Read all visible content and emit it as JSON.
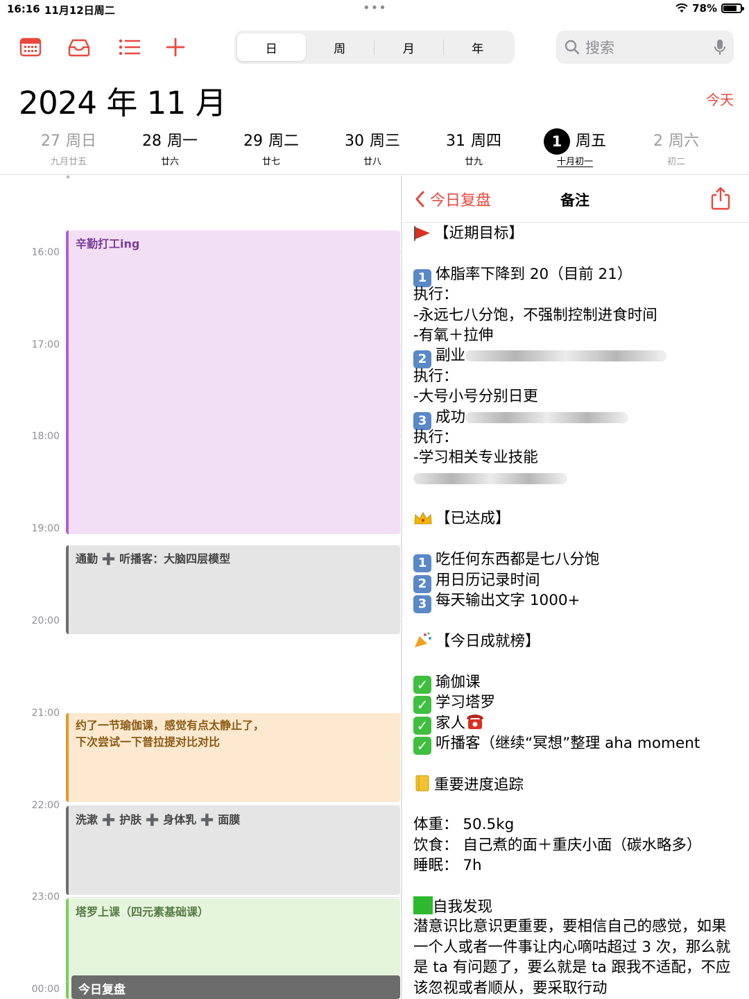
{
  "status_bar": {
    "time": "16:16",
    "date": "11月12日周二",
    "wifi_icon": "wifi-icon",
    "battery_pct": "78%",
    "battery_level": 0.78
  },
  "toolbar": {
    "icons": [
      "calendar-icon",
      "inbox-icon",
      "list-icon",
      "plus-icon"
    ],
    "segments": [
      "日",
      "周",
      "月",
      "年"
    ],
    "active_segment": 0,
    "search_placeholder": "搜索",
    "accent_color": "#e9473d"
  },
  "header": {
    "title": "2024 年 11 月",
    "today_button": "今天"
  },
  "week": [
    {
      "num": "27",
      "weekday": "周日",
      "lunar": "九月廿五",
      "muted": true
    },
    {
      "num": "28",
      "weekday": "周一",
      "lunar": "廿六",
      "muted": false
    },
    {
      "num": "29",
      "weekday": "周二",
      "lunar": "廿七",
      "muted": false
    },
    {
      "num": "30",
      "weekday": "周三",
      "lunar": "廿八",
      "muted": false
    },
    {
      "num": "31",
      "weekday": "周四",
      "lunar": "廿九",
      "muted": false
    },
    {
      "num": "1",
      "weekday": "周五",
      "lunar": "十月初一",
      "muted": false,
      "selected": true
    },
    {
      "num": "2",
      "weekday": "周六",
      "lunar": "初二",
      "muted": true
    }
  ],
  "timeline": {
    "hours": [
      "16:00",
      "17:00",
      "18:00",
      "19:00",
      "20:00",
      "21:00",
      "22:00",
      "23:00",
      "00:00"
    ],
    "events": [
      {
        "title": "辛勤打工ing",
        "color": "purple"
      },
      {
        "title": "通勤 ➕ 听播客：大脑四层模型",
        "color": "gray"
      },
      {
        "title": "约了一节瑜伽课，感觉有点太静止了，",
        "title2": "下次尝试一下普拉提对比对比",
        "color": "orange"
      },
      {
        "title": "洗漱 ➕ 护肤 ➕ 身体乳 ➕ 面膜",
        "color": "gray"
      },
      {
        "title": "塔罗上课（四元素基础课）",
        "color": "green"
      },
      {
        "title": "今日复盘",
        "color": "darkgray"
      }
    ]
  },
  "notes": {
    "back_label": "今日复盘",
    "title": "备注",
    "share_icon": "share-icon",
    "lines": {
      "goals_header": "【近期目标】",
      "g1": "体脂率下降到 20（目前 21）",
      "exec": "执行：",
      "g1a": "-永远七八分饱，不强制控制进食时间",
      "g1b": "-有氧＋拉伸",
      "g2": "副业",
      "g2a": "-大号小号分别日更",
      "g3": "成功",
      "g3a": "-学习相关专业技能",
      "done_header": "【已达成】",
      "d1": "吃任何东西都是七八分饱",
      "d2": "用日历记录时间",
      "d3": "每天输出文字 1000+",
      "today_header": "【今日成就榜】",
      "t1": "瑜伽课",
      "t2": "学习塔罗",
      "t3": "家人",
      "t4": "听播客（继续“冥想”整理 aha moment",
      "track_header": "重要进度追踪",
      "weight": "体重：  50.5kg",
      "diet": "饮食：  自己煮的面＋重庆小面（碳水略多）",
      "sleep": "睡眠：  7h",
      "self_header": "自我发现",
      "self_text": "潜意识比意识更重要，要相信自己的感觉，如果一个人或者一件事让内心嘀咕超过 3 次，那么就是 ta 有问题了，要么就是 ta 跟我不适配，不应该忽视或者顺从，要采取行动"
    }
  }
}
